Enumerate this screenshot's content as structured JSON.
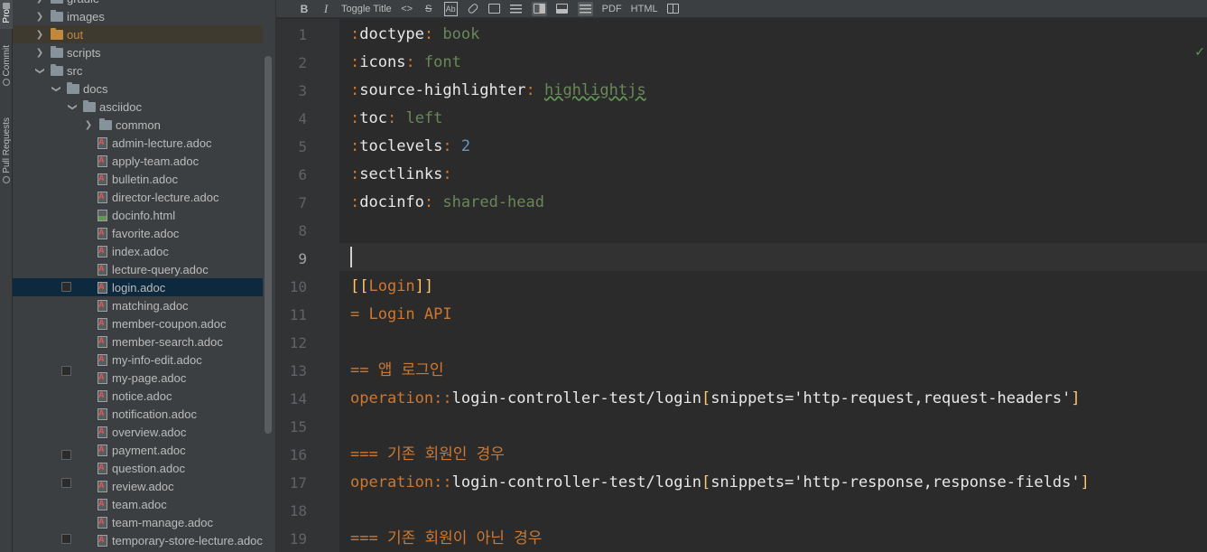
{
  "toolstrip": {
    "tabs": [
      {
        "label": "Pro"
      },
      {
        "label": "Commit"
      },
      {
        "label": "Pull Requests"
      }
    ]
  },
  "tree": {
    "items": [
      {
        "label": "gradle",
        "type": "folder",
        "depth": 1,
        "expanded": false
      },
      {
        "label": "images",
        "type": "folder",
        "depth": 1,
        "expanded": false
      },
      {
        "label": "out",
        "type": "folder",
        "depth": 1,
        "expanded": false,
        "highlight": "excluded"
      },
      {
        "label": "scripts",
        "type": "folder",
        "depth": 1,
        "expanded": false
      },
      {
        "label": "src",
        "type": "folder",
        "depth": 1,
        "expanded": true
      },
      {
        "label": "docs",
        "type": "folder",
        "depth": 2,
        "expanded": true
      },
      {
        "label": "asciidoc",
        "type": "folder",
        "depth": 3,
        "expanded": true
      },
      {
        "label": "common",
        "type": "folder",
        "depth": 4,
        "expanded": false
      },
      {
        "label": "admin-lecture.adoc",
        "type": "adoc",
        "depth": 4
      },
      {
        "label": "apply-team.adoc",
        "type": "adoc",
        "depth": 4
      },
      {
        "label": "bulletin.adoc",
        "type": "adoc",
        "depth": 4
      },
      {
        "label": "director-lecture.adoc",
        "type": "adoc",
        "depth": 4
      },
      {
        "label": "docinfo.html",
        "type": "html",
        "depth": 4
      },
      {
        "label": "favorite.adoc",
        "type": "adoc",
        "depth": 4
      },
      {
        "label": "index.adoc",
        "type": "adoc",
        "depth": 4
      },
      {
        "label": "lecture-query.adoc",
        "type": "adoc",
        "depth": 4
      },
      {
        "label": "login.adoc",
        "type": "adoc",
        "depth": 4,
        "selected": true
      },
      {
        "label": "matching.adoc",
        "type": "adoc",
        "depth": 4
      },
      {
        "label": "member-coupon.adoc",
        "type": "adoc",
        "depth": 4
      },
      {
        "label": "member-search.adoc",
        "type": "adoc",
        "depth": 4
      },
      {
        "label": "my-info-edit.adoc",
        "type": "adoc",
        "depth": 4
      },
      {
        "label": "my-page.adoc",
        "type": "adoc",
        "depth": 4
      },
      {
        "label": "notice.adoc",
        "type": "adoc",
        "depth": 4
      },
      {
        "label": "notification.adoc",
        "type": "adoc",
        "depth": 4
      },
      {
        "label": "overview.adoc",
        "type": "adoc",
        "depth": 4
      },
      {
        "label": "payment.adoc",
        "type": "adoc",
        "depth": 4
      },
      {
        "label": "question.adoc",
        "type": "adoc",
        "depth": 4
      },
      {
        "label": "review.adoc",
        "type": "adoc",
        "depth": 4
      },
      {
        "label": "team.adoc",
        "type": "adoc",
        "depth": 4
      },
      {
        "label": "team-manage.adoc",
        "type": "adoc",
        "depth": 4
      },
      {
        "label": "temporary-store-lecture.adoc",
        "type": "adoc",
        "depth": 4
      }
    ]
  },
  "toolbar": {
    "bold": "B",
    "italic": "I",
    "toggle_title": "Toggle Title",
    "code": "<>",
    "strike": "S",
    "ab": "Ab",
    "pdf": "PDF",
    "html": "HTML"
  },
  "editor": {
    "current_line": 9,
    "lines": [
      {
        "n": "1",
        "parts": [
          {
            "t": ":",
            "c": "attr"
          },
          {
            "t": "doctype",
            "c": "key"
          },
          {
            "t": ": ",
            "c": "attr"
          },
          {
            "t": "book",
            "c": "val"
          }
        ]
      },
      {
        "n": "2",
        "parts": [
          {
            "t": ":",
            "c": "attr"
          },
          {
            "t": "icons",
            "c": "key"
          },
          {
            "t": ": ",
            "c": "attr"
          },
          {
            "t": "font",
            "c": "val"
          }
        ]
      },
      {
        "n": "3",
        "parts": [
          {
            "t": ":",
            "c": "attr"
          },
          {
            "t": "source-highlighter",
            "c": "key"
          },
          {
            "t": ": ",
            "c": "attr"
          },
          {
            "t": "highlightjs",
            "c": "squig"
          }
        ]
      },
      {
        "n": "4",
        "parts": [
          {
            "t": ":",
            "c": "attr"
          },
          {
            "t": "toc",
            "c": "key"
          },
          {
            "t": ": ",
            "c": "attr"
          },
          {
            "t": "left",
            "c": "val"
          }
        ]
      },
      {
        "n": "5",
        "parts": [
          {
            "t": ":",
            "c": "attr"
          },
          {
            "t": "toclevels",
            "c": "key"
          },
          {
            "t": ": ",
            "c": "attr"
          },
          {
            "t": "2",
            "c": "num"
          }
        ]
      },
      {
        "n": "6",
        "parts": [
          {
            "t": ":",
            "c": "attr"
          },
          {
            "t": "sectlinks",
            "c": "key"
          },
          {
            "t": ":",
            "c": "attr"
          }
        ]
      },
      {
        "n": "7",
        "parts": [
          {
            "t": ":",
            "c": "attr"
          },
          {
            "t": "docinfo",
            "c": "key"
          },
          {
            "t": ": ",
            "c": "attr"
          },
          {
            "t": "shared-head",
            "c": "val"
          }
        ]
      },
      {
        "n": "8",
        "parts": []
      },
      {
        "n": "9",
        "parts": []
      },
      {
        "n": "10",
        "fold": true,
        "parts": [
          {
            "t": "[[",
            "c": "brk"
          },
          {
            "t": "Login",
            "c": "hdr"
          },
          {
            "t": "]]",
            "c": "brk"
          }
        ]
      },
      {
        "n": "11",
        "parts": [
          {
            "t": "= Login API",
            "c": "hdr"
          }
        ]
      },
      {
        "n": "12",
        "parts": []
      },
      {
        "n": "13",
        "fold": true,
        "parts": [
          {
            "t": "== 앱 로그인",
            "c": "hdr"
          }
        ]
      },
      {
        "n": "14",
        "parts": [
          {
            "t": "operation::",
            "c": "mac"
          },
          {
            "t": "login-controller-test/login",
            "c": "plain"
          },
          {
            "t": "[",
            "c": "brk"
          },
          {
            "t": "snippets='http-request,request-headers'",
            "c": "strv"
          },
          {
            "t": "]",
            "c": "brk"
          }
        ]
      },
      {
        "n": "15",
        "parts": []
      },
      {
        "n": "16",
        "fold": true,
        "parts": [
          {
            "t": "=== 기존 회원인 경우",
            "c": "hdr"
          }
        ]
      },
      {
        "n": "17",
        "fold": true,
        "parts": [
          {
            "t": "operation::",
            "c": "mac"
          },
          {
            "t": "login-controller-test/login",
            "c": "plain"
          },
          {
            "t": "[",
            "c": "brk"
          },
          {
            "t": "snippets='http-response,response-fields'",
            "c": "strv"
          },
          {
            "t": "]",
            "c": "brk"
          }
        ]
      },
      {
        "n": "18",
        "parts": []
      },
      {
        "n": "19",
        "fold": true,
        "parts": [
          {
            "t": "=== 기존 회원이 아닌 경우",
            "c": "hdr"
          }
        ]
      }
    ]
  },
  "status": {
    "check": "✓"
  }
}
